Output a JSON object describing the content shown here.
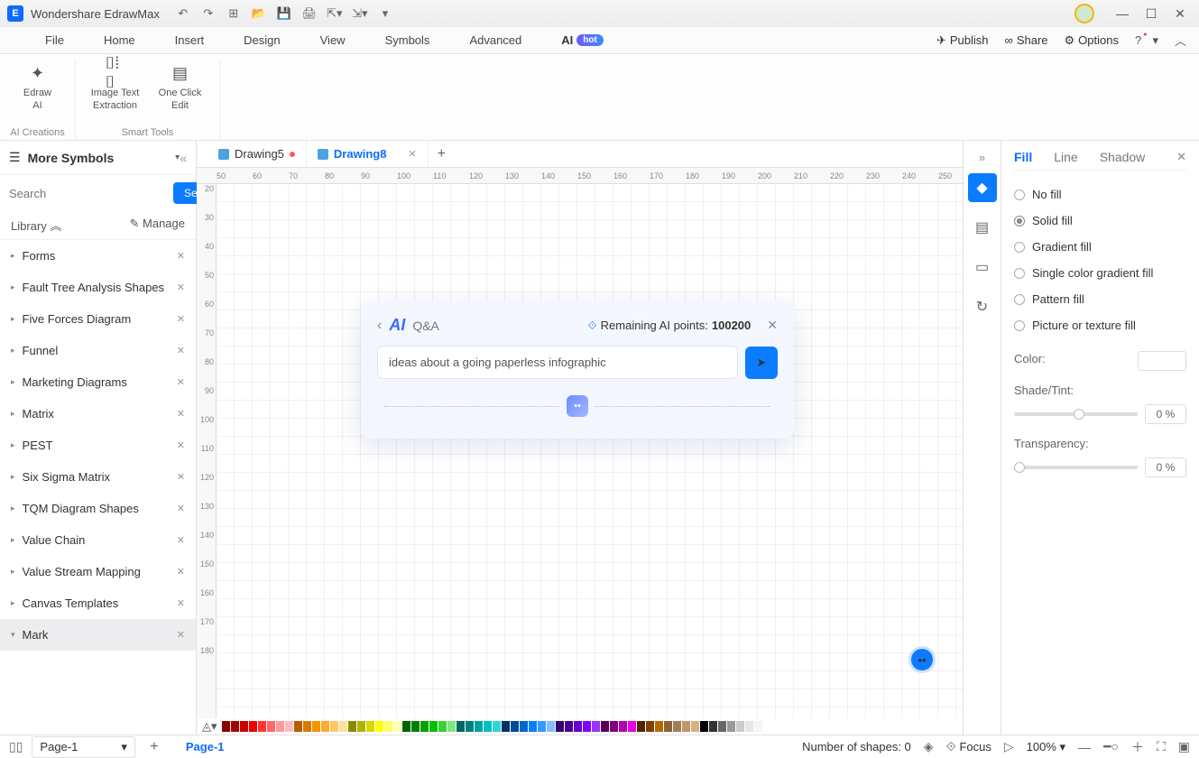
{
  "app": {
    "title": "Wondershare EdrawMax"
  },
  "menus": [
    "File",
    "Home",
    "Insert",
    "Design",
    "View",
    "Symbols",
    "Advanced",
    "AI"
  ],
  "menu_badge": "hot",
  "menubar_right": {
    "publish": "Publish",
    "share": "Share",
    "options": "Options"
  },
  "ribbon": {
    "group1_label": "AI Creations",
    "group2_label": "Smart Tools",
    "btn1": "Edraw\nAI",
    "btn2": "Image Text\nExtraction",
    "btn3": "One Click\nEdit"
  },
  "sidebar": {
    "title": "More Symbols",
    "search_placeholder": "Search",
    "search_btn": "Search",
    "library": "Library",
    "manage": "Manage",
    "cats": [
      "Forms",
      "Fault Tree Analysis Shapes",
      "Five Forces Diagram",
      "Funnel",
      "Marketing Diagrams",
      "Matrix",
      "PEST",
      "Six Sigma Matrix",
      "TQM Diagram Shapes",
      "Value Chain",
      "Value Stream Mapping",
      "Canvas Templates",
      "Mark"
    ]
  },
  "docs": {
    "tab1": "Drawing5",
    "tab2": "Drawing8"
  },
  "ai_dialog": {
    "mode": "Q&A",
    "points_label": "Remaining AI points:",
    "points_value": "100200",
    "input_value": "ideas about a going paperless infographic"
  },
  "right_panel": {
    "tabs": [
      "Fill",
      "Line",
      "Shadow"
    ],
    "options": [
      "No fill",
      "Solid fill",
      "Gradient fill",
      "Single color gradient fill",
      "Pattern fill",
      "Picture or texture fill"
    ],
    "color_label": "Color:",
    "shade_label": "Shade/Tint:",
    "trans_label": "Transparency:",
    "pct": "0 %"
  },
  "ruler_h": [
    50,
    60,
    70,
    80,
    90,
    100,
    110,
    120,
    130,
    140,
    150,
    160,
    170,
    180,
    190,
    200,
    210,
    220,
    230,
    240,
    250
  ],
  "ruler_v": [
    20,
    30,
    40,
    50,
    60,
    70,
    80,
    90,
    100,
    110,
    120,
    130,
    140,
    150,
    160,
    170,
    180
  ],
  "statusbar": {
    "page_selector": "Page-1",
    "page_tab": "Page-1",
    "shapes": "Number of shapes: 0",
    "focus": "Focus",
    "zoom": "100%"
  },
  "palette": [
    "#8b0000",
    "#a00",
    "#c00",
    "#e00",
    "#f33",
    "#f66",
    "#f99",
    "#fbb",
    "#b85c00",
    "#d97a00",
    "#f59300",
    "#ffab2e",
    "#ffc864",
    "#ffe09b",
    "#8a8a00",
    "#b2b200",
    "#d9d900",
    "#ffff00",
    "#ffff66",
    "#ffffb3",
    "#006400",
    "#008000",
    "#00a000",
    "#00c000",
    "#33d433",
    "#80e680",
    "#006666",
    "#008080",
    "#00a0a0",
    "#00c0c0",
    "#33d4d4",
    "#003366",
    "#004c99",
    "#0066cc",
    "#0080ff",
    "#3399ff",
    "#80bfff",
    "#330066",
    "#4c0099",
    "#6600cc",
    "#8000ff",
    "#9933ff",
    "#550055",
    "#800080",
    "#b300b3",
    "#e600e6",
    "#552200",
    "#804000",
    "#b36b00",
    "#8c6239",
    "#a67c52",
    "#c0956b",
    "#d9af85",
    "#000000",
    "#333333",
    "#666666",
    "#999999",
    "#cccccc",
    "#e6e6e6",
    "#f5f5f5",
    "#ffffff"
  ]
}
